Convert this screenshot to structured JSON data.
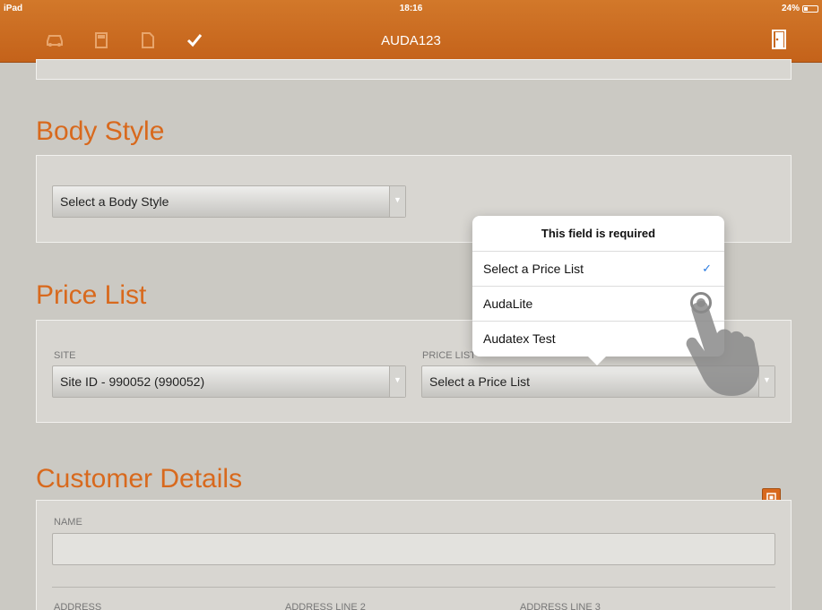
{
  "status_bar": {
    "device": "iPad",
    "time": "18:16",
    "battery": "24%"
  },
  "nav": {
    "title": "AUDA123",
    "icons": [
      "car-icon",
      "calculator-icon",
      "document-icon",
      "checkmark-icon",
      "exit-door-icon"
    ]
  },
  "body_style": {
    "title": "Body Style",
    "select_value": "Select a Body Style"
  },
  "price_list": {
    "title": "Price List",
    "site_label": "SITE",
    "site_value": "Site ID - 990052 (990052)",
    "price_list_label": "PRICE LIST",
    "price_list_value": "Select a Price List"
  },
  "popover": {
    "header": "This field is required",
    "options": [
      {
        "label": "Select a Price List",
        "selected": true
      },
      {
        "label": "AudaLite",
        "selected": false
      },
      {
        "label": "Audatex Test",
        "selected": false
      }
    ]
  },
  "customer_details": {
    "title": "Customer Details",
    "name_label": "NAME",
    "name_value": "",
    "address_label": "ADDRESS",
    "address2_label": "ADDRESS LINE 2",
    "address3_label": "ADDRESS LINE 3"
  },
  "colors": {
    "accent": "#d8691d",
    "nav": "#c96a20",
    "check": "#2a7be0"
  }
}
